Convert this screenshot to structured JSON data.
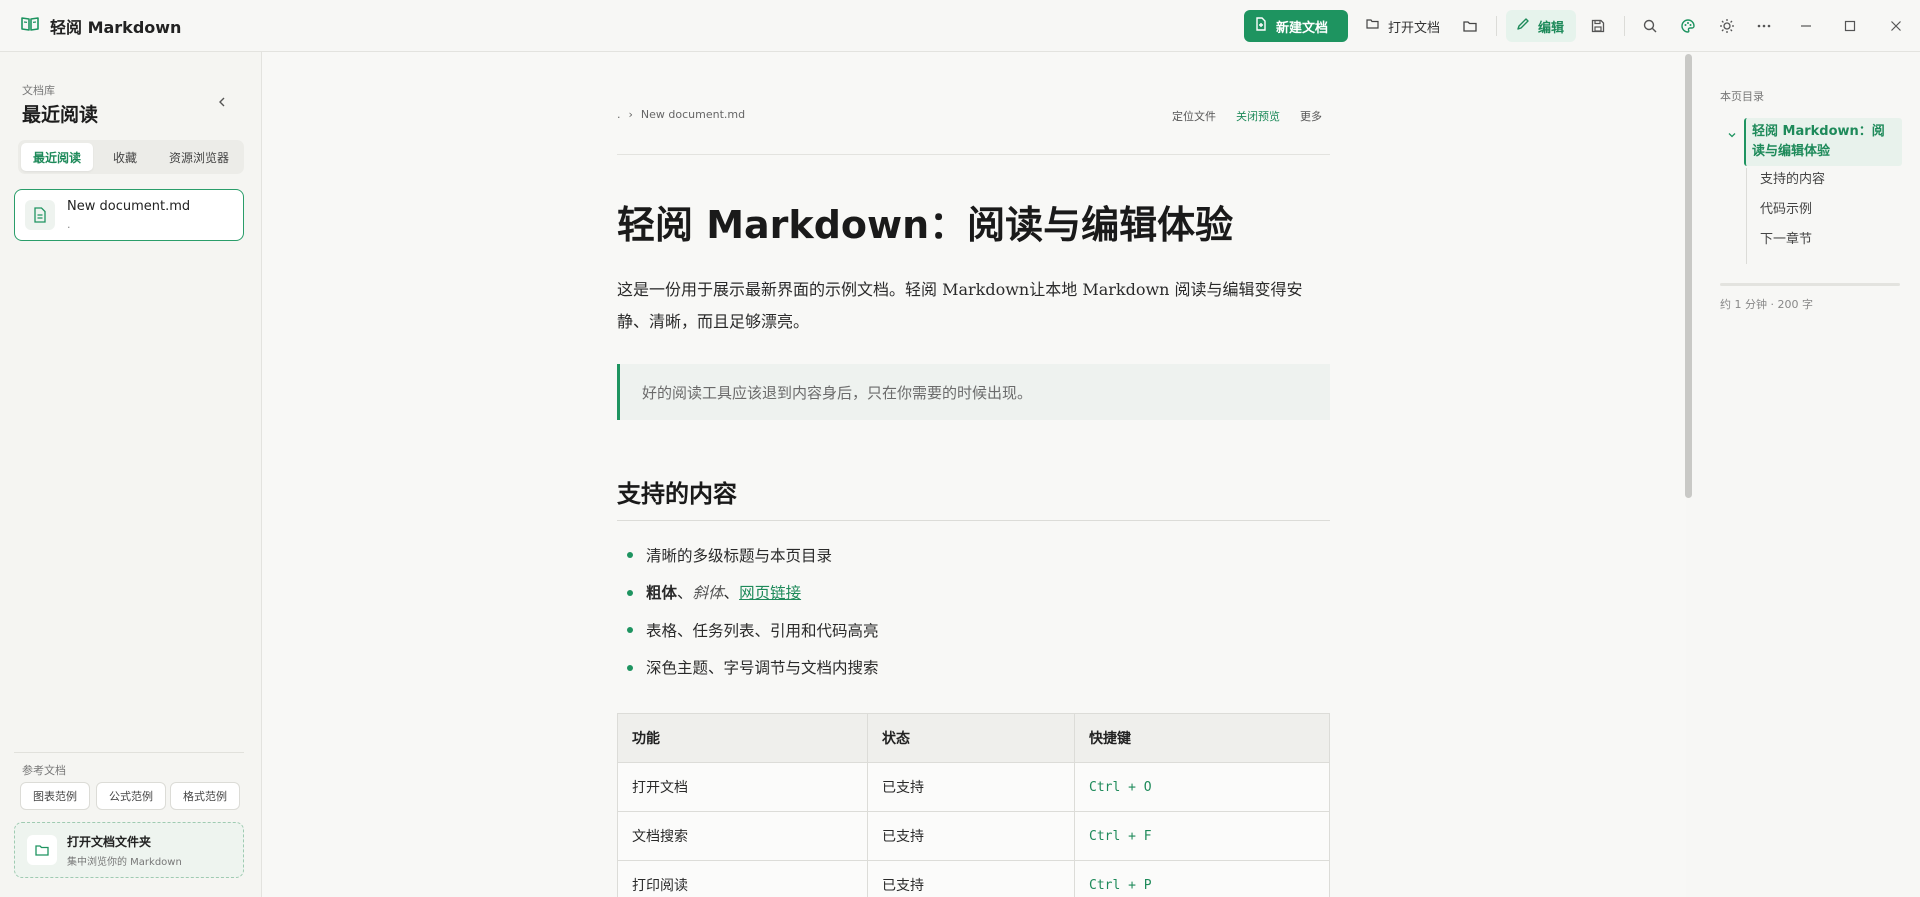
{
  "app": {
    "title": "轻阅 Markdown"
  },
  "toolbar": {
    "new_doc": "新建文档",
    "open_doc": "打开文档",
    "edit": "编辑",
    "icons": [
      "book-icon",
      "file-plus-icon",
      "folder-open-icon",
      "folder-icon",
      "pencil-icon",
      "save-icon",
      "search-icon",
      "palette-icon",
      "sun-icon",
      "more-icon",
      "minimize-icon",
      "maximize-icon",
      "close-icon"
    ]
  },
  "sidebar": {
    "section_label": "文档库",
    "title": "最近阅读",
    "tabs": [
      {
        "label": "最近阅读",
        "active": true
      },
      {
        "label": "收藏",
        "active": false
      },
      {
        "label": "资源浏览器",
        "active": false
      }
    ],
    "documents": [
      {
        "name": "New document.md",
        "path": "."
      }
    ],
    "reference_label": "参考文档",
    "reference_buttons": [
      "图表范例",
      "公式范例",
      "格式范例"
    ],
    "open_folder": {
      "title": "打开文档文件夹",
      "subtitle": "集中浏览你的 Markdown"
    }
  },
  "document": {
    "breadcrumb": [
      ".",
      "New document.md"
    ],
    "actions": {
      "locate": "定位文件",
      "close_preview": "关闭预览",
      "more": "更多"
    },
    "h1": "轻阅 Markdown：阅读与编辑体验",
    "intro": "这是一份用于展示最新界面的示例文档。轻阅 Markdown让本地 Markdown 阅读与编辑变得安静、清晰，而且足够漂亮。",
    "quote": "好的阅读工具应该退到内容身后，只在你需要的时候出现。",
    "h2": "支持的内容",
    "list": {
      "item1": "清晰的多级标题与本页目录",
      "item2_bold": "粗体",
      "item2_sep1": "、",
      "item2_italic": "斜体",
      "item2_sep2": "、",
      "item2_link": "网页链接",
      "item3": "表格、任务列表、引用和代码高亮",
      "item4": "深色主题、字号调节与文档内搜索"
    },
    "table": {
      "headers": [
        "功能",
        "状态",
        "快捷键"
      ],
      "rows": [
        [
          "打开文档",
          "已支持",
          "Ctrl + O"
        ],
        [
          "文档搜索",
          "已支持",
          "Ctrl + F"
        ],
        [
          "打印阅读",
          "已支持",
          "Ctrl + P"
        ]
      ]
    }
  },
  "toc": {
    "label": "本页目录",
    "active": "轻阅 Markdown：阅读与编辑体验",
    "items": [
      "支持的内容",
      "代码示例",
      "下一章节"
    ],
    "meta": "约 1 分钟 · 200 字"
  },
  "colors": {
    "accent": "#1e9460",
    "accent_text": "#1e8a5a"
  }
}
